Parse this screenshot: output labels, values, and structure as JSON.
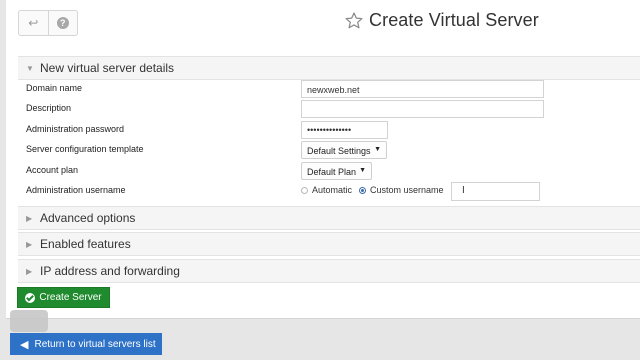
{
  "header": {
    "title": "Create Virtual Server",
    "back_icon": "↩",
    "help_icon": "?"
  },
  "sections": {
    "details": "New virtual server details",
    "advanced": "Advanced options",
    "features": "Enabled features",
    "ip": "IP address and forwarding"
  },
  "form": {
    "domain_label": "Domain name",
    "domain_value": "newxweb.net",
    "description_label": "Description",
    "description_value": "",
    "password_label": "Administration password",
    "password_value": "••••••••••••••",
    "template_label": "Server configuration template",
    "template_value": "Default Settings",
    "plan_label": "Account plan",
    "plan_value": "Default Plan",
    "username_label": "Administration username",
    "username_auto": "Automatic",
    "username_custom": "Custom username",
    "username_value": "",
    "selected_username_mode": "Custom username"
  },
  "buttons": {
    "create": "Create Server",
    "return": "Return to virtual servers list"
  },
  "colors": {
    "create": "#1f8a2e",
    "return": "#2d72c6"
  }
}
